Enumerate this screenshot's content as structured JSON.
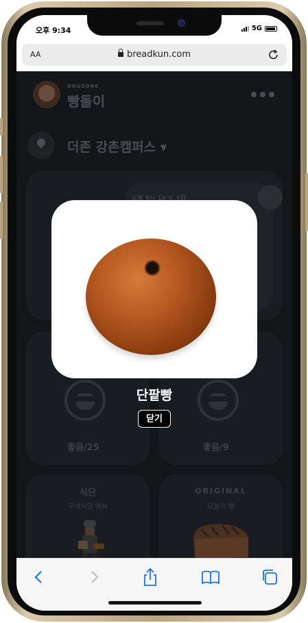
{
  "status": {
    "time": "오후 9:34",
    "network": "5G"
  },
  "browser": {
    "aa_label": "AA",
    "url": "breadkun.com"
  },
  "header": {
    "brand_small": "DOUZONE",
    "brand_name": "빵돌이"
  },
  "location": {
    "name": "더존 강촌캠퍼스 ▾"
  },
  "weather": {
    "text": "오후 9시   19°C   3日"
  },
  "likes": [
    {
      "label": "좋음/25"
    },
    {
      "label": "좋음/9"
    }
  ],
  "menu_cards": [
    {
      "title": "식단",
      "subtitle": "구내식당 메뉴"
    },
    {
      "title": "ORIGINAL",
      "subtitle": "오늘의 빵"
    }
  ],
  "modal": {
    "title": "단팥빵",
    "close_label": "닫기"
  },
  "toolbar": {
    "items": [
      "back-icon",
      "forward-icon",
      "share-icon",
      "bookmarks-icon",
      "tabs-icon"
    ]
  },
  "colors": {
    "accent": "#1a73e8",
    "overlay": "#141518"
  }
}
